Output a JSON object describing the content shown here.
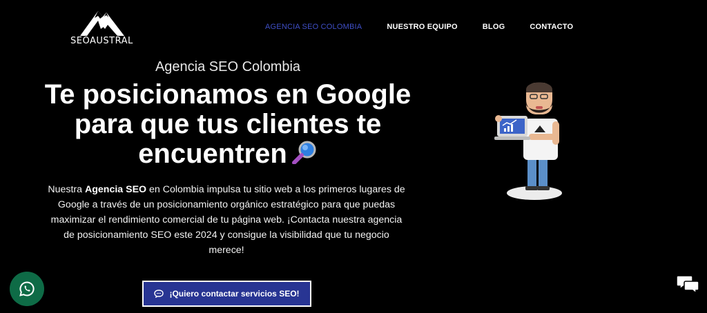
{
  "brand": {
    "name": "SEOAUSTRAL"
  },
  "nav": {
    "items": [
      {
        "label": "AGENCIA SEO COLOMBIA",
        "active": true
      },
      {
        "label": "NUESTRO EQUIPO",
        "active": false
      },
      {
        "label": "BLOG",
        "active": false
      },
      {
        "label": "CONTACTO",
        "active": false
      }
    ]
  },
  "hero": {
    "eyebrow": "Agencia SEO Colombia",
    "title": "Te posicionamos en Google para que tus clientes te encuentren",
    "lead_pre": "Nuestra ",
    "lead_bold": "Agencia SEO",
    "lead_post": " en Colombia impulsa tu sitio web a los primeros lugares de Google a través de un posicionamiento orgánico estratégico para que puedas maximizar el rendimiento comercial de tu página web. ¡Contacta nuestra agencia de posicionamiento SEO este 2024 y consigue la visibilidad que tu negocio merece!",
    "cta_label": "¡Quiero contactar servicios SEO!"
  },
  "colors": {
    "background": "#000000",
    "accent": "#283593",
    "nav_active": "#3f4fc7",
    "whatsapp": "#0e6b46"
  },
  "icons": [
    "mountain-logo-icon",
    "magnifier-icon",
    "chat-bubble-icon",
    "whatsapp-icon",
    "chat-bubbles-icon"
  ]
}
